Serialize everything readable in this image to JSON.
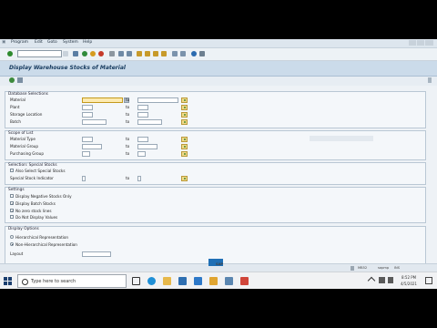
{
  "menu": [
    "Program",
    "Edit",
    "Goto",
    "System",
    "Help"
  ],
  "title": "Display Warehouse Stocks of Material",
  "database_selections": {
    "heading": "Database Selections",
    "fields": [
      {
        "label": "Material",
        "to_label": "to"
      },
      {
        "label": "Plant",
        "to_label": "to"
      },
      {
        "label": "Storage Location",
        "to_label": "to"
      },
      {
        "label": "Batch",
        "to_label": "to"
      }
    ]
  },
  "scope_of_list": {
    "heading": "Scope of List",
    "fields": [
      {
        "label": "Material Type",
        "to_label": "to"
      },
      {
        "label": "Material Group",
        "to_label": "to"
      },
      {
        "label": "Purchasing Group",
        "to_label": "to"
      }
    ]
  },
  "special_stocks": {
    "heading": "Selection: Special Stocks",
    "also_select_label": "Also Select Special Stocks",
    "indicator_label": "Special Stock Indicator",
    "to_label": "to"
  },
  "settings": {
    "heading": "Settings",
    "options": [
      {
        "label": "Display Negative Stocks Only",
        "checked": false
      },
      {
        "label": "Display Batch Stocks",
        "checked": true
      },
      {
        "label": "No zero stock lines",
        "checked": true
      },
      {
        "label": "Do Not Display Values",
        "checked": false
      }
    ]
  },
  "display_options": {
    "heading": "Display Options",
    "radios": [
      {
        "label": "Hierarchical Representation",
        "selected": false
      },
      {
        "label": "Non-Hierarchical Representation",
        "selected": true
      }
    ],
    "layout_label": "Layout"
  },
  "status": {
    "brand": "SAP",
    "system": "MB52",
    "client": "sapmp",
    "mode": "INS"
  },
  "taskbar": {
    "search_placeholder": "Type here to search",
    "time": "8:52 PM",
    "date": "4/5/2021"
  },
  "colors": {
    "title_bar": "#cbdbea",
    "highlight_field": "#fdeab0",
    "background": "#eef2f6"
  }
}
